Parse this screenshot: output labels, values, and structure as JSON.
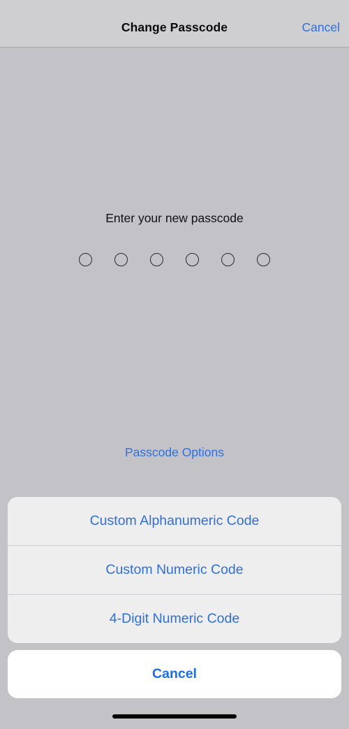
{
  "navbar": {
    "title": "Change Passcode",
    "cancel_label": "Cancel"
  },
  "main": {
    "prompt": "Enter your new passcode",
    "passcode": {
      "length": 6,
      "entered": 0,
      "dots": [
        "",
        "",
        "",
        "",
        "",
        ""
      ]
    },
    "passcode_options_label": "Passcode Options"
  },
  "action_sheet": {
    "options": [
      {
        "label": "Custom Alphanumeric Code"
      },
      {
        "label": "Custom Numeric Code"
      },
      {
        "label": "4-Digit Numeric Code"
      }
    ],
    "cancel_label": "Cancel"
  },
  "colors": {
    "accent_blue": "#2f6fe0",
    "sheet_blue": "#2f6fe0",
    "cancel_blue": "#1a6ef5",
    "background": "#c3c3c7",
    "navbar_background": "#cfcfd1",
    "sheet_background": "#eeeeef",
    "cancel_background": "#ffffff"
  }
}
